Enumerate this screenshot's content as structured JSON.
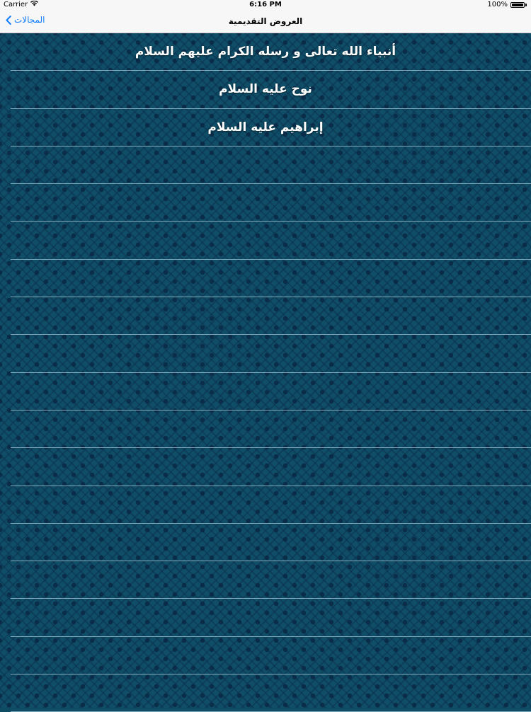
{
  "status_bar": {
    "carrier": "Carrier",
    "time": "6:16 PM",
    "battery": "100%",
    "battery_level": 1.0
  },
  "nav": {
    "title": "العروض التقديمية",
    "back_label": "المجالات"
  },
  "rows": [
    {
      "label": "أنبياء الله تعالى و رسله الكرام عليهم السلام"
    },
    {
      "label": "نوح عليه السلام"
    },
    {
      "label": "إبراهيم عليه السلام"
    },
    {
      "label": ""
    },
    {
      "label": ""
    },
    {
      "label": ""
    },
    {
      "label": ""
    },
    {
      "label": ""
    },
    {
      "label": ""
    },
    {
      "label": ""
    },
    {
      "label": ""
    },
    {
      "label": ""
    },
    {
      "label": ""
    },
    {
      "label": ""
    },
    {
      "label": ""
    },
    {
      "label": ""
    },
    {
      "label": ""
    },
    {
      "label": ""
    }
  ],
  "colors": {
    "accent": "#147efb",
    "background": "#0f4e66",
    "separator": "#aacddc"
  }
}
